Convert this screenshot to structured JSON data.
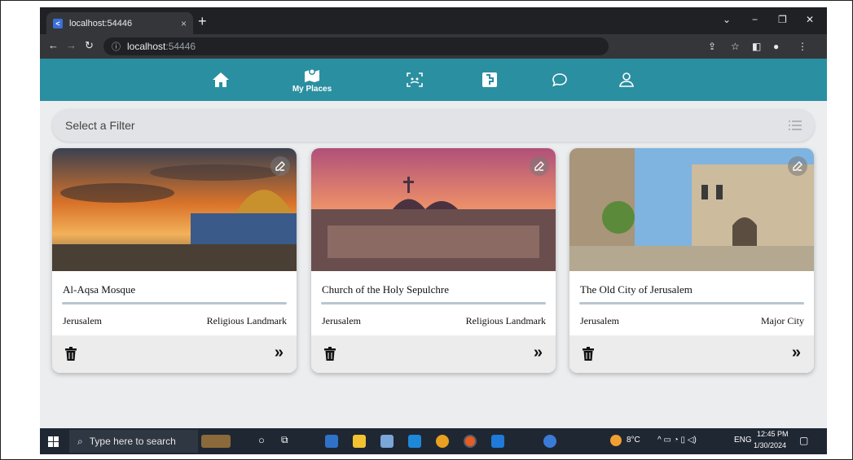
{
  "browser": {
    "tab_title": "localhost:54446",
    "tab_close": "×",
    "new_tab": "+",
    "address_host": "localhost",
    "address_port": ":54446",
    "window_controls": [
      "⌄",
      "−",
      "❐",
      "✕"
    ]
  },
  "appnav": {
    "items": [
      {
        "icon": "home-icon",
        "label": ""
      },
      {
        "icon": "map-places-icon",
        "label": "My Places"
      },
      {
        "icon": "scan-icon",
        "label": ""
      },
      {
        "icon": "puzzle-icon",
        "label": ""
      },
      {
        "icon": "chat-icon",
        "label": ""
      },
      {
        "icon": "user-icon",
        "label": ""
      }
    ]
  },
  "filter": {
    "placeholder": "Select a Filter",
    "icon": "list-filter-icon"
  },
  "places": [
    {
      "name": "Al-Aqsa Mosque",
      "city": "Jerusalem",
      "category": "Religious Landmark"
    },
    {
      "name": "Church of the Holy Sepulchre",
      "city": "Jerusalem",
      "category": "Religious Landmark"
    },
    {
      "name": "The Old City of Jerusalem",
      "city": "Jerusalem",
      "category": "Major City"
    }
  ],
  "card_actions": {
    "next_symbol": "»"
  },
  "taskbar": {
    "search_placeholder": "Type here to search",
    "weather": "8°C",
    "language": "ENG",
    "time": "12:45 PM",
    "date": "1/30/2024"
  },
  "colors": {
    "nav_bg": "#2a8fa0",
    "page_bg": "#ecedef",
    "divider": "#b8c6cf"
  }
}
